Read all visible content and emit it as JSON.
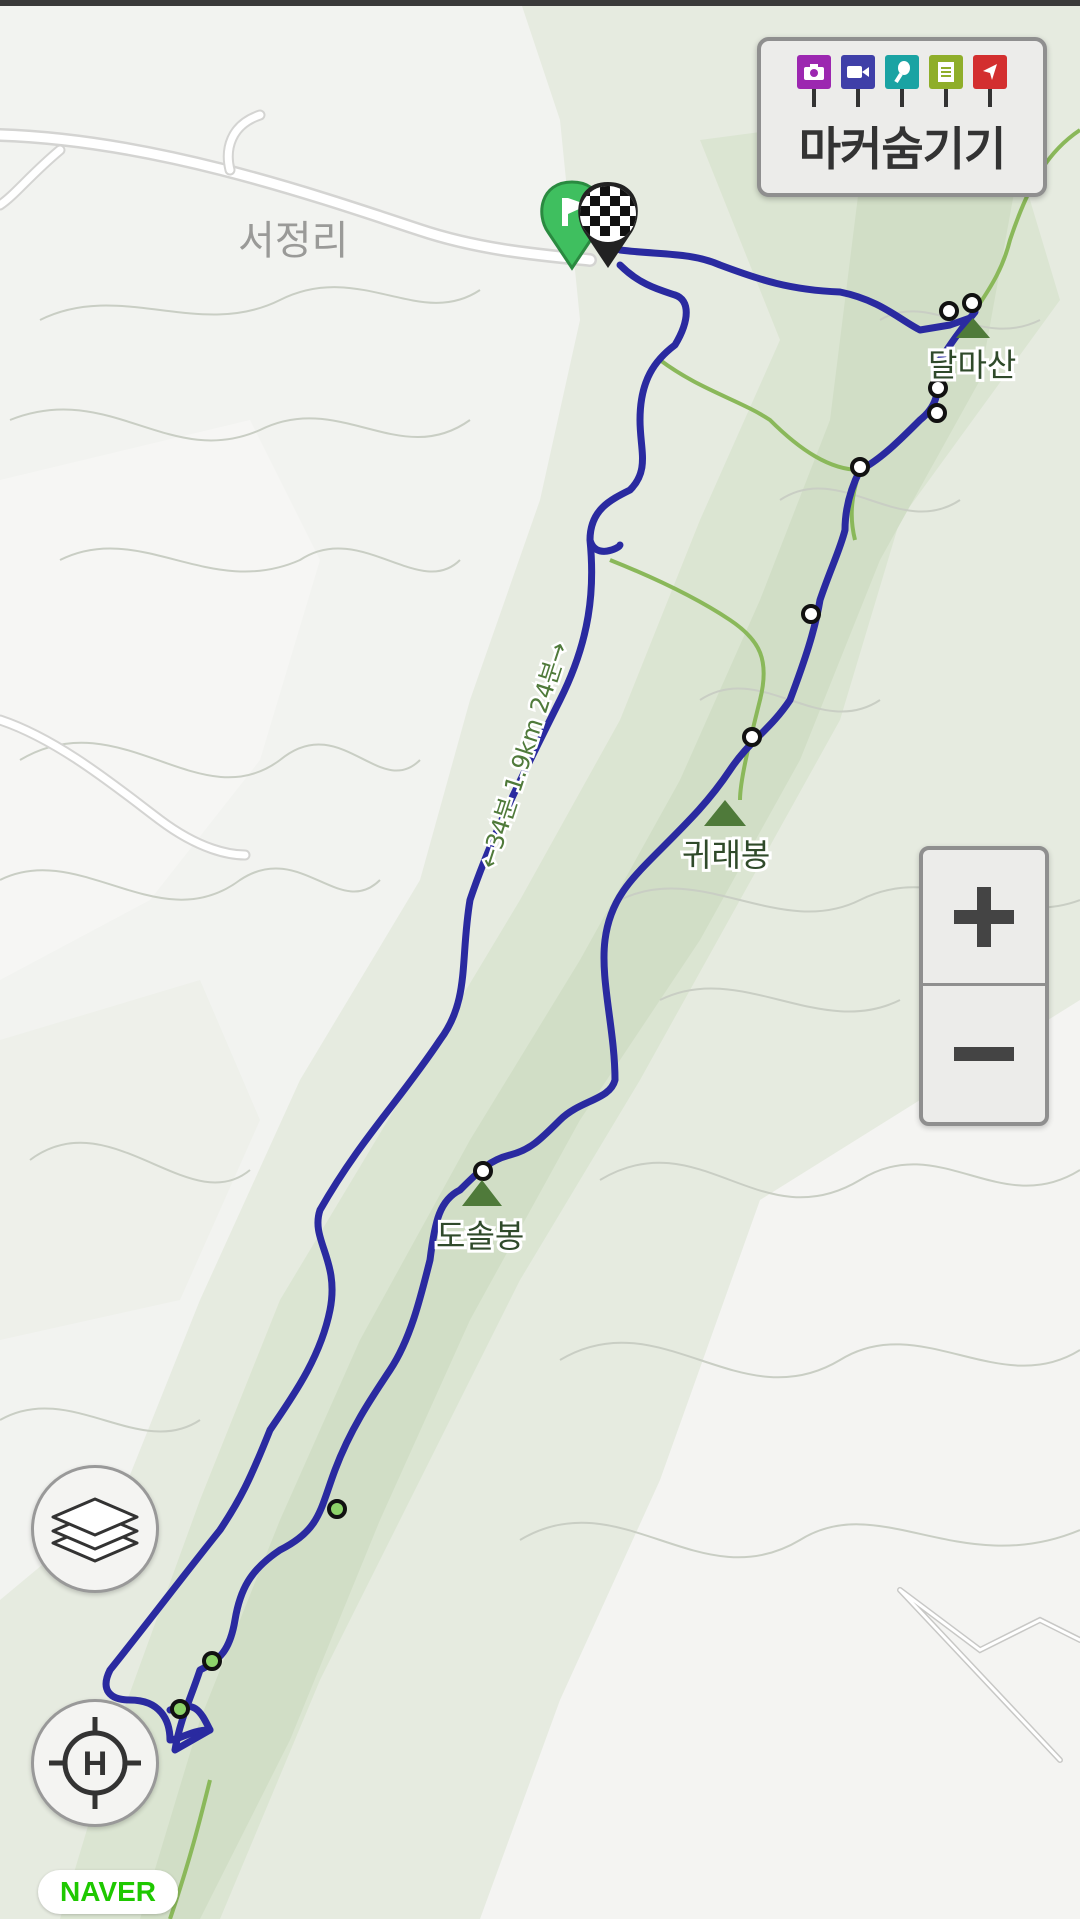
{
  "map": {
    "places": {
      "village": "서정리",
      "peak1": "달마산",
      "peak2": "귀래봉",
      "peak3": "도솔봉"
    },
    "route_label": "←34분 1.9km 24분→",
    "track_color": "#2a2aa0",
    "trail_color": "#8ab85a"
  },
  "marker_panel": {
    "label": "마커숨기기",
    "icons": [
      {
        "name": "camera-icon",
        "color": "#9c27b0"
      },
      {
        "name": "video-icon",
        "color": "#3f3fa8"
      },
      {
        "name": "microphone-icon",
        "color": "#1aa3a3"
      },
      {
        "name": "memo-icon",
        "color": "#8fae2a"
      },
      {
        "name": "flag-icon",
        "color": "#d32f2f"
      }
    ]
  },
  "zoom": {
    "in_icon": "plus-icon",
    "out_icon": "minus-icon"
  },
  "controls": {
    "layers_icon": "layers-icon",
    "locate_icon": "locate-icon"
  },
  "brand": {
    "logo": "NAVER",
    "color": "#1ec800"
  }
}
